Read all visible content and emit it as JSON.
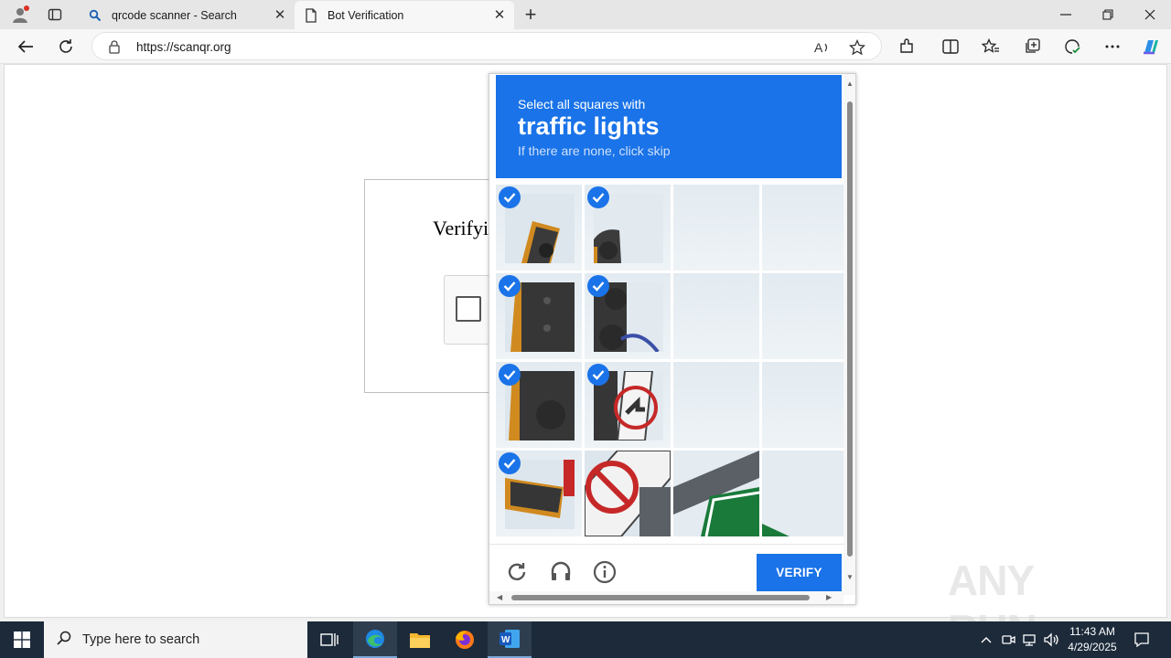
{
  "browser": {
    "tabs": [
      {
        "title": "qrcode scanner - Search"
      },
      {
        "title": "Bot Verification"
      }
    ],
    "url": "https://scanqr.org"
  },
  "page": {
    "verify_title": "Verifyi"
  },
  "captcha": {
    "instruction": "Select all squares with",
    "target": "traffic lights",
    "hint": "If there are none, click skip",
    "verify_label": "VERIFY",
    "selected_cells": [
      0,
      1,
      4,
      5,
      8,
      9,
      12
    ]
  },
  "taskbar": {
    "search_placeholder": "Type here to search",
    "time": "11:43 AM",
    "date": "4/29/2025"
  },
  "watermark": "ANY RUN",
  "colors": {
    "accent": "#1a73e8",
    "taskbar": "#1c2a3a"
  }
}
